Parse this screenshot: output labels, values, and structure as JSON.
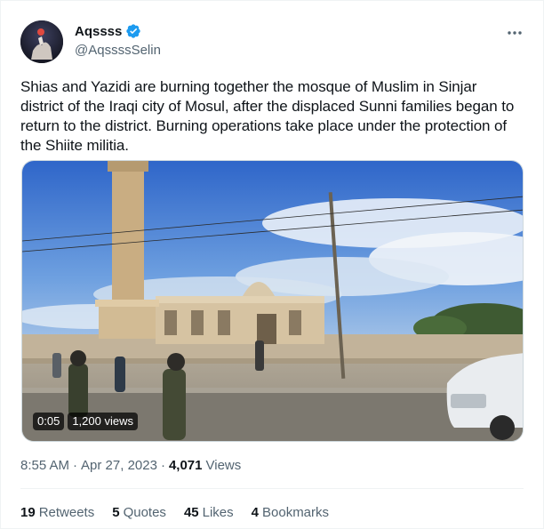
{
  "user": {
    "display_name": "Aqssss",
    "handle": "@AqssssSelin",
    "verified": true
  },
  "tweet": {
    "text": "Shias and Yazidi are burning together the mosque of Muslim in Sinjar district of the Iraqi city of Mosul, after the displaced Sunni families began to return to the district. Burning operations take place under the protection of the Shiite militia.",
    "time": "8:55 AM",
    "separator": "·",
    "date": "Apr 27, 2023",
    "views_count": "4,071",
    "views_label": "Views"
  },
  "video": {
    "duration": "0:05",
    "views": "1,200 views"
  },
  "stats": {
    "retweets_count": "19",
    "retweets_label": "Retweets",
    "quotes_count": "5",
    "quotes_label": "Quotes",
    "likes_count": "45",
    "likes_label": "Likes",
    "bookmarks_count": "4",
    "bookmarks_label": "Bookmarks"
  },
  "colors": {
    "verified_blue": "#1d9bf0",
    "text_primary": "#0f1419",
    "text_secondary": "#536471"
  }
}
